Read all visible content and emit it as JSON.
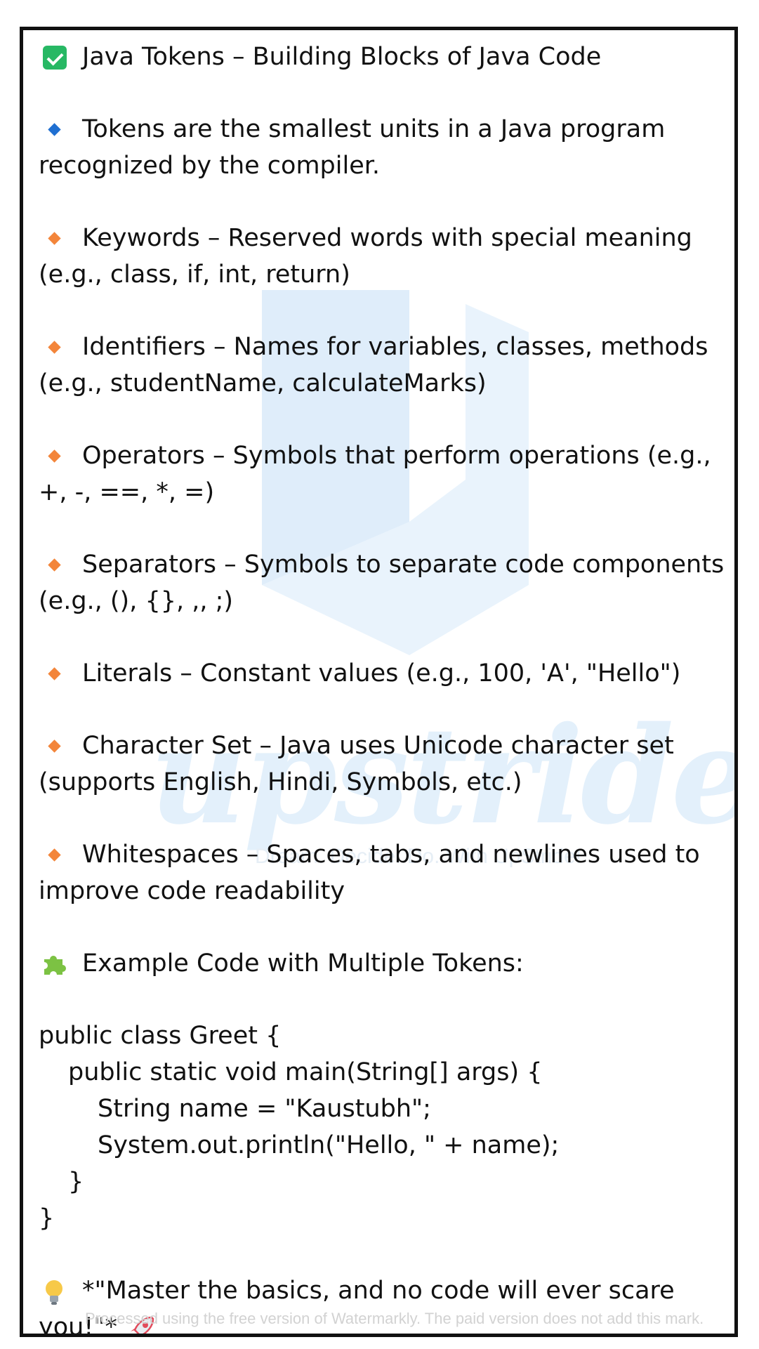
{
  "title": "Java Tokens – Building Blocks of Java Code",
  "intro": {
    "line1": "Tokens are the smallest units in a Java program",
    "line2": "recognized by the compiler."
  },
  "items": [
    {
      "line1": "Keywords – Reserved words with special meaning",
      "line2": "(e.g., class, if, int, return)"
    },
    {
      "line1": "Identifiers – Names for variables, classes, methods",
      "line2": "(e.g., studentName, calculateMarks)"
    },
    {
      "line1": "Operators – Symbols that perform operations (e.g.,",
      "line2": "+, -, ==, *, =)"
    },
    {
      "line1": "Separators – Symbols to separate code components",
      "line2": "(e.g., (), {}, ,, ;)"
    },
    {
      "line1": "Literals – Constant values (e.g., 100, 'A', \"Hello\")",
      "line2": ""
    },
    {
      "line1": "Character Set – Java uses Unicode character set",
      "line2": "(supports English, Hindi, Symbols, etc.)"
    },
    {
      "line1": "Whitespaces – Spaces, tabs, and newlines used to",
      "line2": "improve code readability"
    }
  ],
  "example_heading": "Example Code with Multiple Tokens:",
  "code": [
    "public class Greet {",
    "public static void main(String[] args) {",
    "String name = \"Kaustubh\";",
    "System.out.println(\"Hello, \" + name);",
    "}",
    "}"
  ],
  "quote": {
    "line1": "*\"Master the basics, and no code will ever scare",
    "line2": "you!\"*"
  },
  "watermark": {
    "brand": "upstride",
    "tagline": "Dream. Decide. Do. With UpStride!",
    "notice": "Processed using the free version of Watermarkly. The paid version does not add this mark."
  },
  "icons": {
    "title": "check-icon",
    "intro": "blue-diamond-icon",
    "items": "orange-diamond-icon",
    "example": "puzzle-icon",
    "quote": "bulb-icon",
    "quote_end": "rocket-icon"
  },
  "colors": {
    "check": "#27b864",
    "blue_diamond": "#1f6fd1",
    "orange_diamond": "#f3853a",
    "watermark": "#e3f0fb"
  }
}
